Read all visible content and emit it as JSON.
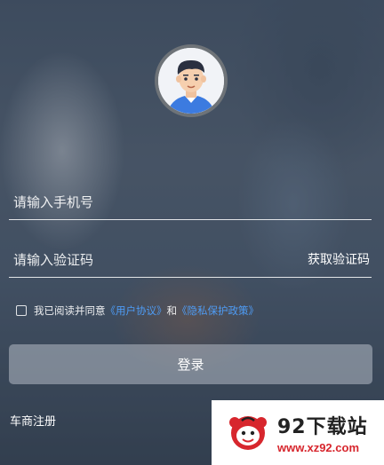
{
  "form": {
    "phone_placeholder": "请输入手机号",
    "code_placeholder": "请输入验证码",
    "get_code_label": "获取验证码"
  },
  "agreement": {
    "prefix": "我已阅读并同意",
    "user_agreement_link": "《用户协议》",
    "conjunction": "和",
    "privacy_link": "《隐私保护政策》"
  },
  "login_label": "登录",
  "register_label": "车商注册",
  "watermark": {
    "title": "92下载站",
    "url": "www.xz92.com"
  },
  "colors": {
    "link": "#4e9cf5",
    "watermark_red": "#d7262d"
  }
}
